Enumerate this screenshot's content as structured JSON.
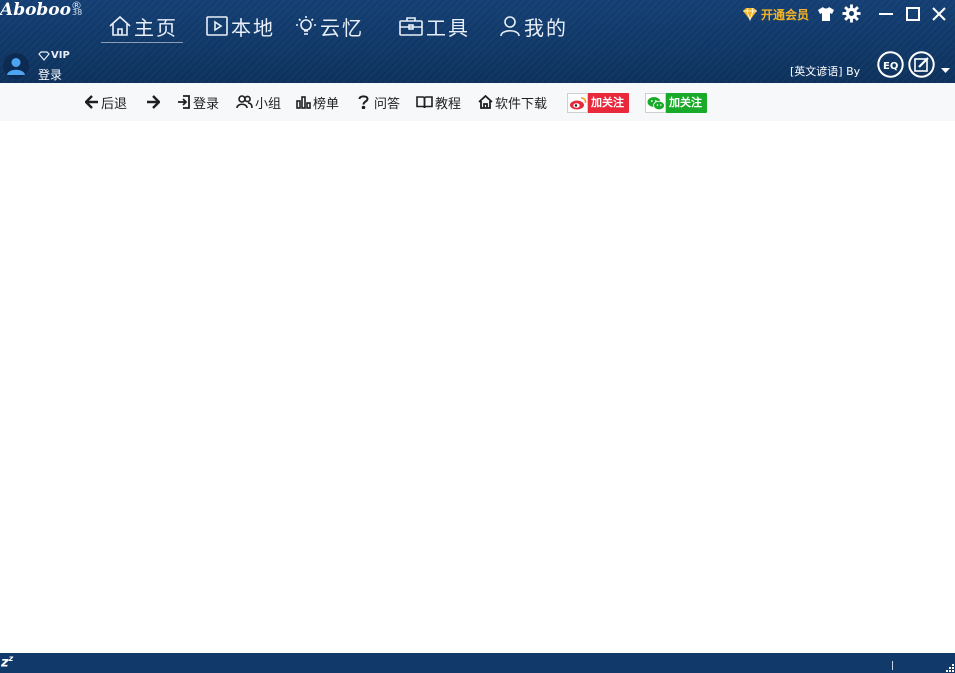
{
  "app": {
    "logo": "Aboboo",
    "logo_mark": "®",
    "logo_version": "38"
  },
  "nav": [
    {
      "id": "home",
      "label": "主页",
      "icon": "home-icon",
      "active": true
    },
    {
      "id": "local",
      "label": "本地",
      "icon": "video-icon"
    },
    {
      "id": "cloud",
      "label": "云忆",
      "icon": "lightbulb-icon"
    },
    {
      "id": "tools",
      "label": "工具",
      "icon": "toolbox-icon"
    },
    {
      "id": "mine",
      "label": "我的",
      "icon": "user-icon"
    }
  ],
  "header_right": {
    "vip_label": "开通会员",
    "vip_color": "#f5b323",
    "icons": [
      "diamond-icon",
      "tshirt-icon",
      "gear-icon",
      "minimize-icon",
      "maximize-icon",
      "close-icon"
    ]
  },
  "user": {
    "vip_tag": "VIP",
    "login_label": "登录"
  },
  "proverb": {
    "text": "[英文谚语] By"
  },
  "toolbar": {
    "back_label": "后退",
    "login_label": "登录",
    "group_label": "小组",
    "rank_label": "榜单",
    "qa_label": "问答",
    "tutorial_label": "教程",
    "download_label": "软件下载",
    "weibo_follow": "加关注",
    "wechat_follow": "加关注",
    "weibo_color": "#e9283b",
    "wechat_color": "#1aaa2a"
  },
  "statusbar": {
    "sleep_text": "z",
    "sleep_sup": "z"
  },
  "colors": {
    "header_bg": "#113a6b",
    "toolbar_bg": "#f7f8fa"
  }
}
